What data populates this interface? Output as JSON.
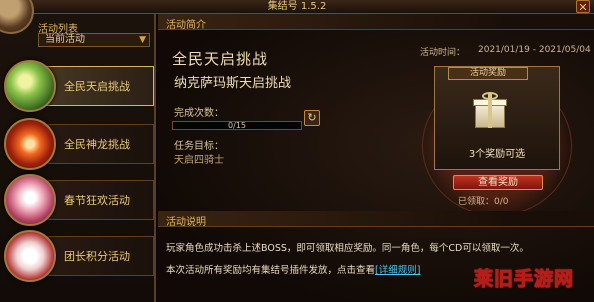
{
  "window": {
    "title": "集结号 1.5.2",
    "close_label": "✕"
  },
  "sidebar": {
    "header": "活动列表",
    "filter": {
      "selected": "当前活动"
    },
    "items": [
      {
        "label": "全民天启挑战",
        "active": true
      },
      {
        "label": "全民神龙挑战",
        "active": false
      },
      {
        "label": "春节狂欢活动",
        "active": false
      },
      {
        "label": "团长积分活动",
        "active": false
      }
    ]
  },
  "main": {
    "intro_header": "活动简介",
    "title": "全民天启挑战",
    "subtitle": "纳克萨玛斯天启挑战",
    "time_label": "活动时间：",
    "time_value": "2021/01/19 - 2021/05/04",
    "complete_label": "完成次数：",
    "progress": {
      "current": 0,
      "total": 15,
      "text": "0/15"
    },
    "task_label": "任务目标：",
    "task_value": "天启四骑士",
    "reward": {
      "tab": "活动奖励",
      "count_text": "3个奖励可选",
      "claim_button": "查看奖励",
      "claimed_text": "已领取：0/0"
    },
    "desc_header": "活动说明",
    "desc_line1": "玩家角色成功击杀上述BOSS，即可领取相应奖励。同一角色，每个CD可以领取一次。",
    "desc_line2_prefix": "本次活动所有奖励均有集结号插件发放，点击查看",
    "rules_link": "[详细规则]"
  },
  "watermark": "莱旧手游网",
  "colors": {
    "accent_gold": "#e9c97a",
    "claim_red": "#c0321f",
    "link_blue": "#4fc7f0"
  }
}
